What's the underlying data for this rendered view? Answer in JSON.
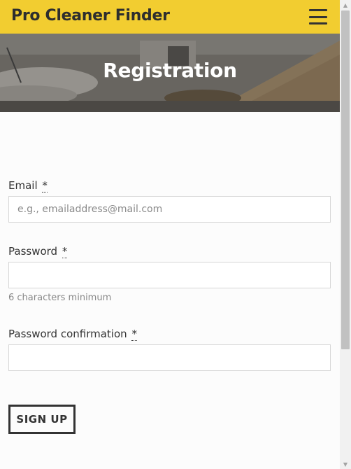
{
  "navbar": {
    "brand": "Pro Cleaner Finder",
    "menu_icon": "hamburger-menu-icon"
  },
  "hero": {
    "title": "Registration"
  },
  "form": {
    "email": {
      "label": "Email",
      "required_mark": "*",
      "value": "",
      "placeholder": "e.g., emailaddress@mail.com"
    },
    "password": {
      "label": "Password",
      "required_mark": "*",
      "value": "",
      "placeholder": "",
      "hint": "6 characters minimum"
    },
    "password_confirmation": {
      "label": "Password confirmation",
      "required_mark": "*",
      "value": "",
      "placeholder": ""
    },
    "submit_label": "SIGN UP"
  },
  "scrollbar": {
    "up_icon": "scroll-up-arrow-icon",
    "down_icon": "scroll-down-arrow-icon"
  },
  "colors": {
    "navbar_bg": "#f2cd30",
    "text": "#333333",
    "hint": "#888888",
    "input_border": "#d6d6d6"
  }
}
